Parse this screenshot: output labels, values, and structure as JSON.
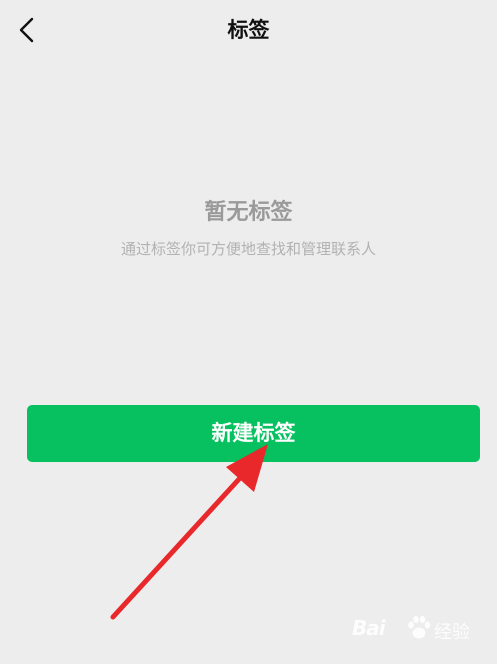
{
  "header": {
    "title": "标签",
    "back_icon": "chevron-left-icon"
  },
  "empty_state": {
    "title": "暂无标签",
    "description": "通过标签你可方便地查找和管理联系人"
  },
  "actions": {
    "new_tag_label": "新建标签"
  },
  "watermark": {
    "logo_text": "Bai",
    "logo_icon": "paw-icon",
    "suffix_text": "经验"
  },
  "colors": {
    "background": "#ededed",
    "primary_green": "#07c160",
    "arrow_red": "#e8282b",
    "title_text": "#111111",
    "muted_text": "#9a9a9a"
  }
}
